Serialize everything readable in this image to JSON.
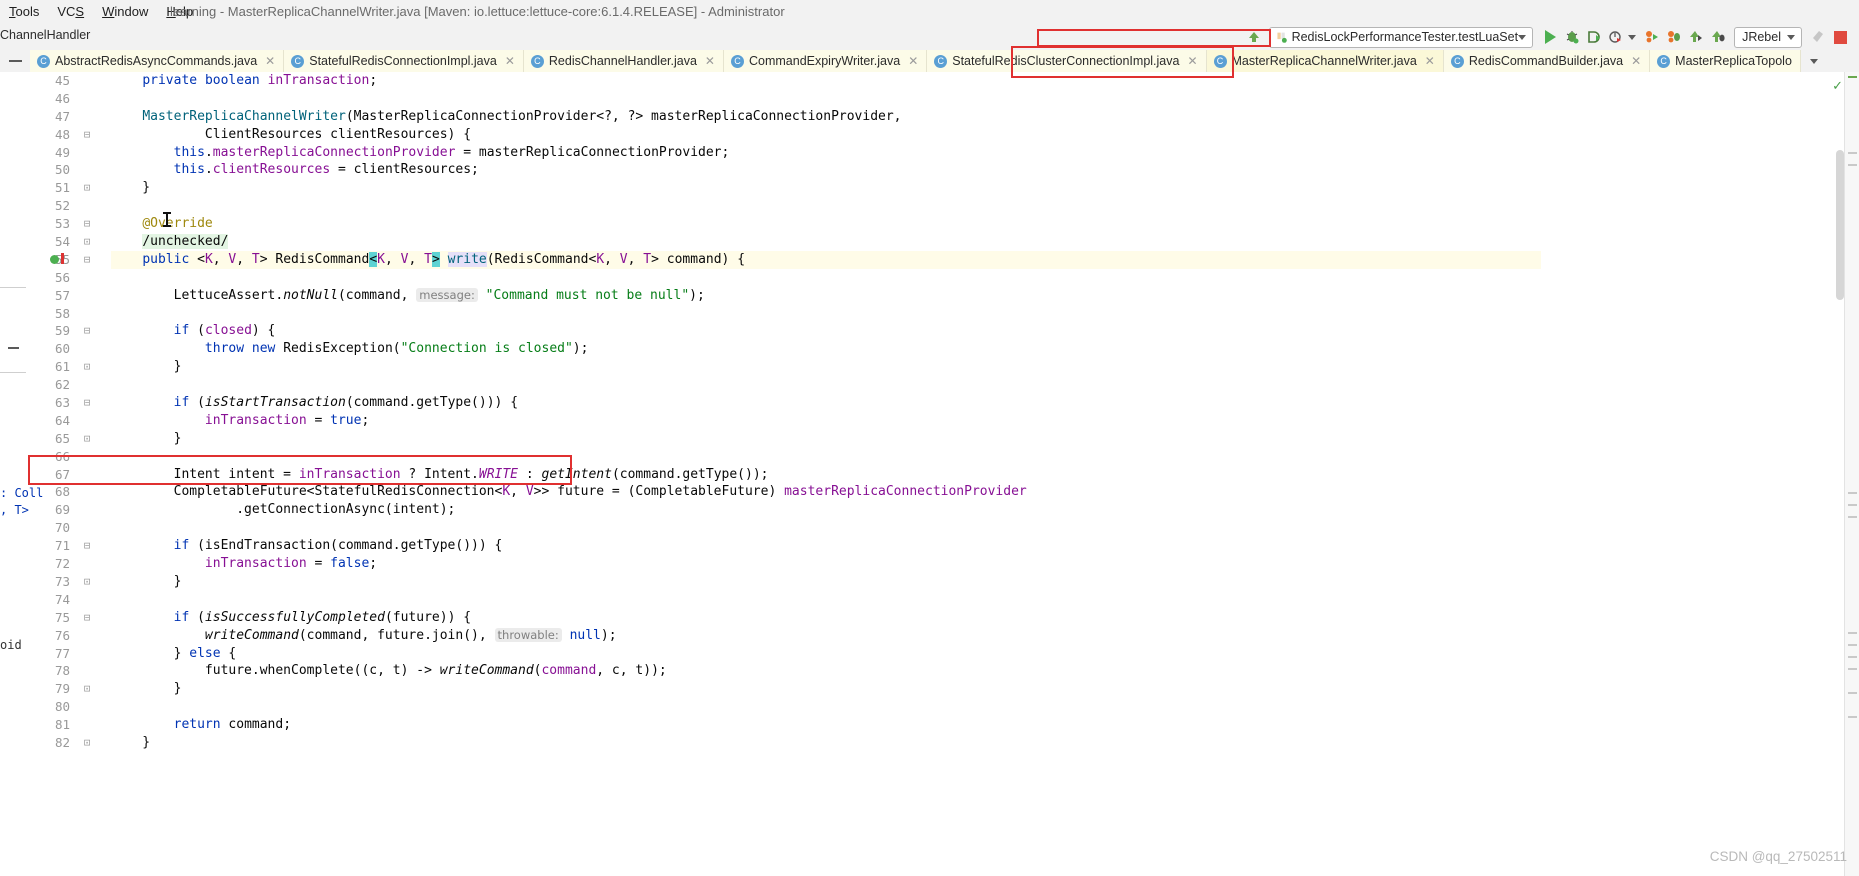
{
  "window": {
    "title": "learning - MasterReplicaChannelWriter.java [Maven: io.lettuce:lettuce-core:6.1.4.RELEASE] - Administrator",
    "menu": [
      "Tools",
      "VCS",
      "Window",
      "Help"
    ]
  },
  "breadcrumb": {
    "text": "ChannelHandler"
  },
  "toolbar": {
    "run_config_label": "RedisLockPerformanceTester.testLuaSet",
    "jrebel_label": "JRebel",
    "icons": [
      "run-icon",
      "debug-icon",
      "run-with-coverage-icon",
      "profile-icon",
      "jrebel-run-icon",
      "jrebel-debug-icon",
      "jrebel-run-alt-icon",
      "jrebel-debug-alt-icon"
    ],
    "stop_icon": "stop-icon",
    "build_icon": "build-icon"
  },
  "tabs": [
    {
      "label": "AbstractRedisAsyncCommands.java",
      "selected": false
    },
    {
      "label": "StatefulRedisConnectionImpl.java",
      "selected": false
    },
    {
      "label": "RedisChannelHandler.java",
      "selected": false
    },
    {
      "label": "CommandExpiryWriter.java",
      "selected": false
    },
    {
      "label": "StatefulRedisClusterConnectionImpl.java",
      "selected": false
    },
    {
      "label": "MasterReplicaChannelWriter.java",
      "selected": true
    },
    {
      "label": "RedisCommandBuilder.java",
      "selected": false
    },
    {
      "label": "MasterReplicaTopolo",
      "selected": false
    }
  ],
  "left_panel": {
    "fragment_1": ": Coll",
    "fragment_2": ", T>",
    "fragment_3": "oid"
  },
  "editor": {
    "first_line_number": 45,
    "highlight_line": 55,
    "lines": [
      {
        "n": 45,
        "fold": "",
        "tokens": [
          {
            "t": "    ",
            "c": "plain"
          },
          {
            "t": "private",
            "c": "kw"
          },
          {
            "t": " ",
            "c": "plain"
          },
          {
            "t": "boolean",
            "c": "kw"
          },
          {
            "t": " ",
            "c": "plain"
          },
          {
            "t": "inTransaction",
            "c": "fld"
          },
          {
            "t": ";",
            "c": "plain"
          }
        ]
      },
      {
        "n": 46,
        "fold": "",
        "tokens": []
      },
      {
        "n": 47,
        "fold": "",
        "tokens": [
          {
            "t": "    ",
            "c": "plain"
          },
          {
            "t": "MasterReplicaChannelWriter",
            "c": "meth"
          },
          {
            "t": "(MasterReplicaConnectionProvider<?, ?> masterReplicaConnectionProvider,",
            "c": "plain"
          }
        ]
      },
      {
        "n": 48,
        "fold": "⊟",
        "tokens": [
          {
            "t": "            ClientResources clientResources) {",
            "c": "plain"
          }
        ]
      },
      {
        "n": 49,
        "fold": "",
        "tokens": [
          {
            "t": "        ",
            "c": "plain"
          },
          {
            "t": "this",
            "c": "kw"
          },
          {
            "t": ".",
            "c": "plain"
          },
          {
            "t": "masterReplicaConnectionProvider",
            "c": "fld"
          },
          {
            "t": " = masterReplicaConnectionProvider;",
            "c": "plain"
          }
        ]
      },
      {
        "n": 50,
        "fold": "",
        "tokens": [
          {
            "t": "        ",
            "c": "plain"
          },
          {
            "t": "this",
            "c": "kw"
          },
          {
            "t": ".",
            "c": "plain"
          },
          {
            "t": "clientResources",
            "c": "fld"
          },
          {
            "t": " = clientResources;",
            "c": "plain"
          }
        ]
      },
      {
        "n": 51,
        "fold": "⊡",
        "tokens": [
          {
            "t": "    }",
            "c": "plain"
          }
        ]
      },
      {
        "n": 52,
        "fold": "",
        "tokens": []
      },
      {
        "n": 53,
        "fold": "⊟",
        "tokens": [
          {
            "t": "    ",
            "c": "plain"
          },
          {
            "t": "@Override",
            "c": "anno"
          }
        ]
      },
      {
        "n": 54,
        "fold": "⊡",
        "tokens": [
          {
            "t": "    ",
            "c": "plain"
          },
          {
            "t": "/unchecked/",
            "c": "plain ann-green"
          }
        ]
      },
      {
        "n": 55,
        "fold": "⊟",
        "tokens": [
          {
            "t": "    ",
            "c": "plain"
          },
          {
            "t": "public",
            "c": "kw"
          },
          {
            "t": " <",
            "c": "plain"
          },
          {
            "t": "K",
            "c": "fld"
          },
          {
            "t": ", ",
            "c": "plain"
          },
          {
            "t": "V",
            "c": "fld"
          },
          {
            "t": ", ",
            "c": "plain"
          },
          {
            "t": "T",
            "c": "fld"
          },
          {
            "t": "> RedisCommand",
            "c": "plain"
          },
          {
            "t": "<",
            "c": "plain sel-teal"
          },
          {
            "t": "K",
            "c": "fld"
          },
          {
            "t": ", ",
            "c": "plain"
          },
          {
            "t": "V",
            "c": "fld"
          },
          {
            "t": ", ",
            "c": "plain"
          },
          {
            "t": "T",
            "c": "fld"
          },
          {
            "t": ">",
            "c": "plain sel-teal"
          },
          {
            "t": " ",
            "c": "plain"
          },
          {
            "t": "write",
            "c": "meth sel-lav"
          },
          {
            "t": "(RedisCommand<",
            "c": "plain"
          },
          {
            "t": "K",
            "c": "fld"
          },
          {
            "t": ", ",
            "c": "plain"
          },
          {
            "t": "V",
            "c": "fld"
          },
          {
            "t": ", ",
            "c": "plain"
          },
          {
            "t": "T",
            "c": "fld"
          },
          {
            "t": "> command) {",
            "c": "plain"
          }
        ]
      },
      {
        "n": 56,
        "fold": "",
        "tokens": []
      },
      {
        "n": 57,
        "fold": "",
        "tokens": [
          {
            "t": "        LettuceAssert.",
            "c": "plain"
          },
          {
            "t": "notNull",
            "c": "plain ital"
          },
          {
            "t": "(command, ",
            "c": "plain"
          },
          {
            "t": "message:",
            "c": "hint"
          },
          {
            "t": " ",
            "c": "plain"
          },
          {
            "t": "\"Command must not be null\"",
            "c": "str"
          },
          {
            "t": ");",
            "c": "plain"
          }
        ]
      },
      {
        "n": 58,
        "fold": "",
        "tokens": []
      },
      {
        "n": 59,
        "fold": "⊟",
        "tokens": [
          {
            "t": "        ",
            "c": "plain"
          },
          {
            "t": "if",
            "c": "kw"
          },
          {
            "t": " (",
            "c": "plain"
          },
          {
            "t": "closed",
            "c": "fld"
          },
          {
            "t": ") {",
            "c": "plain"
          }
        ]
      },
      {
        "n": 60,
        "fold": "",
        "tokens": [
          {
            "t": "            ",
            "c": "plain"
          },
          {
            "t": "throw",
            "c": "kw"
          },
          {
            "t": " ",
            "c": "plain"
          },
          {
            "t": "new",
            "c": "kw"
          },
          {
            "t": " RedisException(",
            "c": "plain"
          },
          {
            "t": "\"Connection is closed\"",
            "c": "str"
          },
          {
            "t": ");",
            "c": "plain"
          }
        ]
      },
      {
        "n": 61,
        "fold": "⊡",
        "tokens": [
          {
            "t": "        }",
            "c": "plain"
          }
        ]
      },
      {
        "n": 62,
        "fold": "",
        "tokens": []
      },
      {
        "n": 63,
        "fold": "⊟",
        "tokens": [
          {
            "t": "        ",
            "c": "plain"
          },
          {
            "t": "if",
            "c": "kw"
          },
          {
            "t": " (",
            "c": "plain"
          },
          {
            "t": "isStartTransaction",
            "c": "plain ital"
          },
          {
            "t": "(command.getType())) {",
            "c": "plain"
          }
        ]
      },
      {
        "n": 64,
        "fold": "",
        "tokens": [
          {
            "t": "            ",
            "c": "plain"
          },
          {
            "t": "inTransaction",
            "c": "fld"
          },
          {
            "t": " = ",
            "c": "plain"
          },
          {
            "t": "true",
            "c": "kw"
          },
          {
            "t": ";",
            "c": "plain"
          }
        ]
      },
      {
        "n": 65,
        "fold": "⊡",
        "tokens": [
          {
            "t": "        }",
            "c": "plain"
          }
        ]
      },
      {
        "n": 66,
        "fold": "",
        "tokens": []
      },
      {
        "n": 67,
        "fold": "",
        "tokens": [
          {
            "t": "        Intent intent = ",
            "c": "plain"
          },
          {
            "t": "inTransaction",
            "c": "fld"
          },
          {
            "t": " ? Intent.",
            "c": "plain"
          },
          {
            "t": "WRITE",
            "c": "fld ital"
          },
          {
            "t": " : ",
            "c": "plain"
          },
          {
            "t": "getIntent",
            "c": "plain ital"
          },
          {
            "t": "(command.getType());",
            "c": "plain"
          }
        ]
      },
      {
        "n": 68,
        "fold": "",
        "tokens": [
          {
            "t": "        CompletableFuture<StatefulRedisConnection<",
            "c": "plain"
          },
          {
            "t": "K",
            "c": "fld"
          },
          {
            "t": ", ",
            "c": "plain"
          },
          {
            "t": "V",
            "c": "fld"
          },
          {
            "t": ">> future = (CompletableFuture) ",
            "c": "plain"
          },
          {
            "t": "masterReplicaConnectionProvider",
            "c": "fld"
          }
        ]
      },
      {
        "n": 69,
        "fold": "",
        "tokens": [
          {
            "t": "                .getConnectionAsync(intent);",
            "c": "plain"
          }
        ]
      },
      {
        "n": 70,
        "fold": "",
        "tokens": []
      },
      {
        "n": 71,
        "fold": "⊟",
        "tokens": [
          {
            "t": "        ",
            "c": "plain"
          },
          {
            "t": "if",
            "c": "kw"
          },
          {
            "t": " (isEndTransaction(command.getType())) {",
            "c": "plain"
          }
        ]
      },
      {
        "n": 72,
        "fold": "",
        "tokens": [
          {
            "t": "            ",
            "c": "plain"
          },
          {
            "t": "inTransaction",
            "c": "fld"
          },
          {
            "t": " = ",
            "c": "plain"
          },
          {
            "t": "false",
            "c": "kw"
          },
          {
            "t": ";",
            "c": "plain"
          }
        ]
      },
      {
        "n": 73,
        "fold": "⊡",
        "tokens": [
          {
            "t": "        }",
            "c": "plain"
          }
        ]
      },
      {
        "n": 74,
        "fold": "",
        "tokens": []
      },
      {
        "n": 75,
        "fold": "⊟",
        "tokens": [
          {
            "t": "        ",
            "c": "plain"
          },
          {
            "t": "if",
            "c": "kw"
          },
          {
            "t": " (",
            "c": "plain"
          },
          {
            "t": "isSuccessfullyCompleted",
            "c": "plain ital"
          },
          {
            "t": "(future)) {",
            "c": "plain"
          }
        ]
      },
      {
        "n": 76,
        "fold": "",
        "tokens": [
          {
            "t": "            ",
            "c": "plain"
          },
          {
            "t": "writeCommand",
            "c": "plain ital"
          },
          {
            "t": "(command, future.join(), ",
            "c": "plain"
          },
          {
            "t": "throwable:",
            "c": "hint"
          },
          {
            "t": " ",
            "c": "plain"
          },
          {
            "t": "null",
            "c": "kw"
          },
          {
            "t": ");",
            "c": "plain"
          }
        ]
      },
      {
        "n": 77,
        "fold": "",
        "tokens": [
          {
            "t": "        } ",
            "c": "plain"
          },
          {
            "t": "else",
            "c": "kw"
          },
          {
            "t": " {",
            "c": "plain"
          }
        ]
      },
      {
        "n": 78,
        "fold": "",
        "tokens": [
          {
            "t": "            future.whenComplete((c, t) -> ",
            "c": "plain"
          },
          {
            "t": "writeCommand",
            "c": "plain ital"
          },
          {
            "t": "(",
            "c": "plain"
          },
          {
            "t": "command",
            "c": "fld"
          },
          {
            "t": ", c, t));",
            "c": "plain"
          }
        ]
      },
      {
        "n": 79,
        "fold": "⊡",
        "tokens": [
          {
            "t": "        }",
            "c": "plain"
          }
        ]
      },
      {
        "n": 80,
        "fold": "",
        "tokens": []
      },
      {
        "n": 81,
        "fold": "",
        "tokens": [
          {
            "t": "        ",
            "c": "plain"
          },
          {
            "t": "return",
            "c": "kw"
          },
          {
            "t": " command;",
            "c": "plain"
          }
        ]
      },
      {
        "n": 82,
        "fold": "⊡",
        "tokens": [
          {
            "t": "    }",
            "c": "plain"
          }
        ]
      }
    ]
  },
  "annotations": {
    "box_run_config": "RedisLockPerformanceTester.testLuaSet",
    "box_tab": "MasterReplicaChannelWriter.java",
    "box_code_line": "Intent intent = inTransaction ? Intent.WRITE : getIntent(command.getType());"
  },
  "watermark": "CSDN @qq_27502511",
  "colors": {
    "accent_green": "#4caf50",
    "annotation_red": "#e03030",
    "tab_selected_bg": "#fbf8d8",
    "keyword": "#0033b3",
    "string": "#067d17",
    "field": "#871094"
  }
}
